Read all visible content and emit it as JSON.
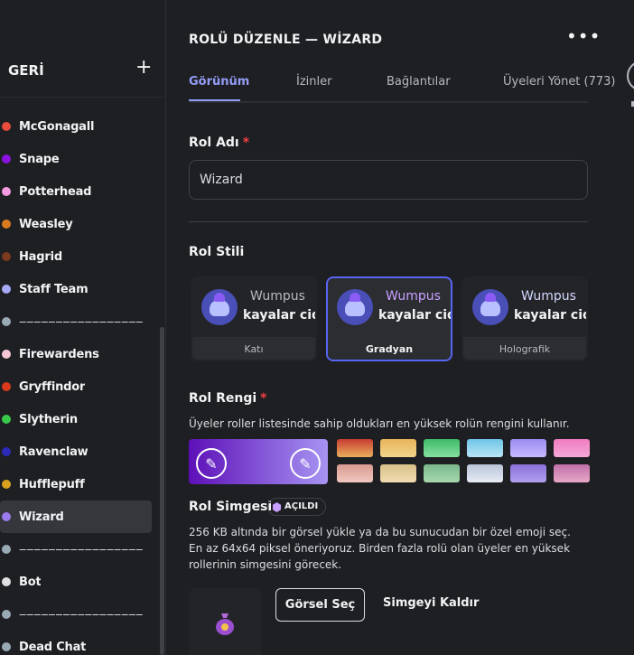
{
  "sidebar": {
    "back_label": "GERİ",
    "add_icon": "plus-icon",
    "roles": [
      {
        "label": "McGonagall",
        "color": "#e74c3c",
        "dim": false
      },
      {
        "label": "Snape",
        "color": "#8a12e0",
        "dim": false
      },
      {
        "label": "Potterhead",
        "color": "#f49be0",
        "dim": false
      },
      {
        "label": "Weasley",
        "color": "#d97b1e",
        "dim": false
      },
      {
        "label": "Hagrid",
        "color": "#7a3a1e",
        "dim": false
      },
      {
        "label": "Staff Team",
        "color": "#a6a9f5",
        "dim": false
      },
      {
        "label": "‒‒‒‒‒‒‒‒‒‒‒‒‒‒‒‒‒",
        "color": "#99aab5",
        "dim": true
      },
      {
        "label": "Firewardens",
        "color": "#f7c6d4",
        "dim": false
      },
      {
        "label": "Gryffindor",
        "color": "#d93a1e",
        "dim": false
      },
      {
        "label": "Slytherin",
        "color": "#37c94a",
        "dim": false
      },
      {
        "label": "Ravenclaw",
        "color": "#2b2bb8",
        "dim": false
      },
      {
        "label": "Hufflepuff",
        "color": "#d9a21e",
        "dim": false
      },
      {
        "label": "Wizard",
        "color": "#9b7bf0",
        "dim": false,
        "active": true
      },
      {
        "label": "‒‒‒‒‒‒‒‒‒‒‒‒‒‒‒‒‒",
        "color": "#99aab5",
        "dim": true
      },
      {
        "label": "Bot",
        "color": "#e0e0e0",
        "dim": false
      },
      {
        "label": "‒‒‒‒‒‒‒‒‒‒‒‒‒‒‒‒‒",
        "color": "#99aab5",
        "dim": true
      },
      {
        "label": "Dead Chat",
        "color": "#99aab5",
        "dim": false
      }
    ]
  },
  "header": {
    "title": "ROLÜ DÜZENLE — WİZARD",
    "more_icon": "more-dots-icon"
  },
  "tabs": [
    {
      "label": "Görünüm",
      "active": true
    },
    {
      "label": "İzinler",
      "active": false
    },
    {
      "label": "Bağlantılar",
      "active": false
    },
    {
      "label": "Üyeleri Yönet (773)",
      "active": false
    }
  ],
  "role_name": {
    "label": "Rol Adı",
    "required_mark": "*",
    "value": "Wizard"
  },
  "role_style": {
    "label": "Rol Stili",
    "preview_name": "Wumpus",
    "preview_message": "kayalar cidden",
    "options": [
      {
        "label": "Katı",
        "selected": false
      },
      {
        "label": "Gradyan",
        "selected": true
      },
      {
        "label": "Holografik",
        "selected": false
      }
    ]
  },
  "role_color": {
    "label": "Rol Rengi",
    "required_mark": "*",
    "description": "Üyeler roller listesinde sahip oldukları en yüksek rolün rengini kullanır.",
    "gradient_start": "#5d10b8",
    "gradient_end": "#a794f2",
    "picker_icon": "eyedropper-icon",
    "presets": [
      [
        "#c93c33",
        "#e8ae5c"
      ],
      [
        "#e8b35c",
        "#f2d58c"
      ],
      [
        "#3fba6a",
        "#86e0a0"
      ],
      [
        "#6fc4e8",
        "#b8e6f5"
      ],
      [
        "#9a8cf0",
        "#c8b8ff"
      ],
      [
        "#f07cc0",
        "#f5a8d8"
      ],
      [
        "#d89a90",
        "#f0c8c0"
      ],
      [
        "#d8c088",
        "#f0dcb0"
      ],
      [
        "#7ab88a",
        "#a8d8b0"
      ],
      [
        "#b8c4d8",
        "#e8ecf5"
      ],
      [
        "#8a70d8",
        "#b0a0f0"
      ],
      [
        "#c070a8",
        "#e8a8c8"
      ]
    ]
  },
  "role_icon": {
    "label": "Rol Simgesi",
    "badge": "AÇILDI",
    "description": "256 KB altında bir görsel yükle ya da bu sunucudan bir özel emoji seç. En az 64x64 piksel öneriyoruz. Birden fazla rolü olan üyeler en yüksek rollerinin simgesini görecek.",
    "choose_button": "Görsel Seç",
    "remove_button": "Simgeyi Kaldır"
  }
}
